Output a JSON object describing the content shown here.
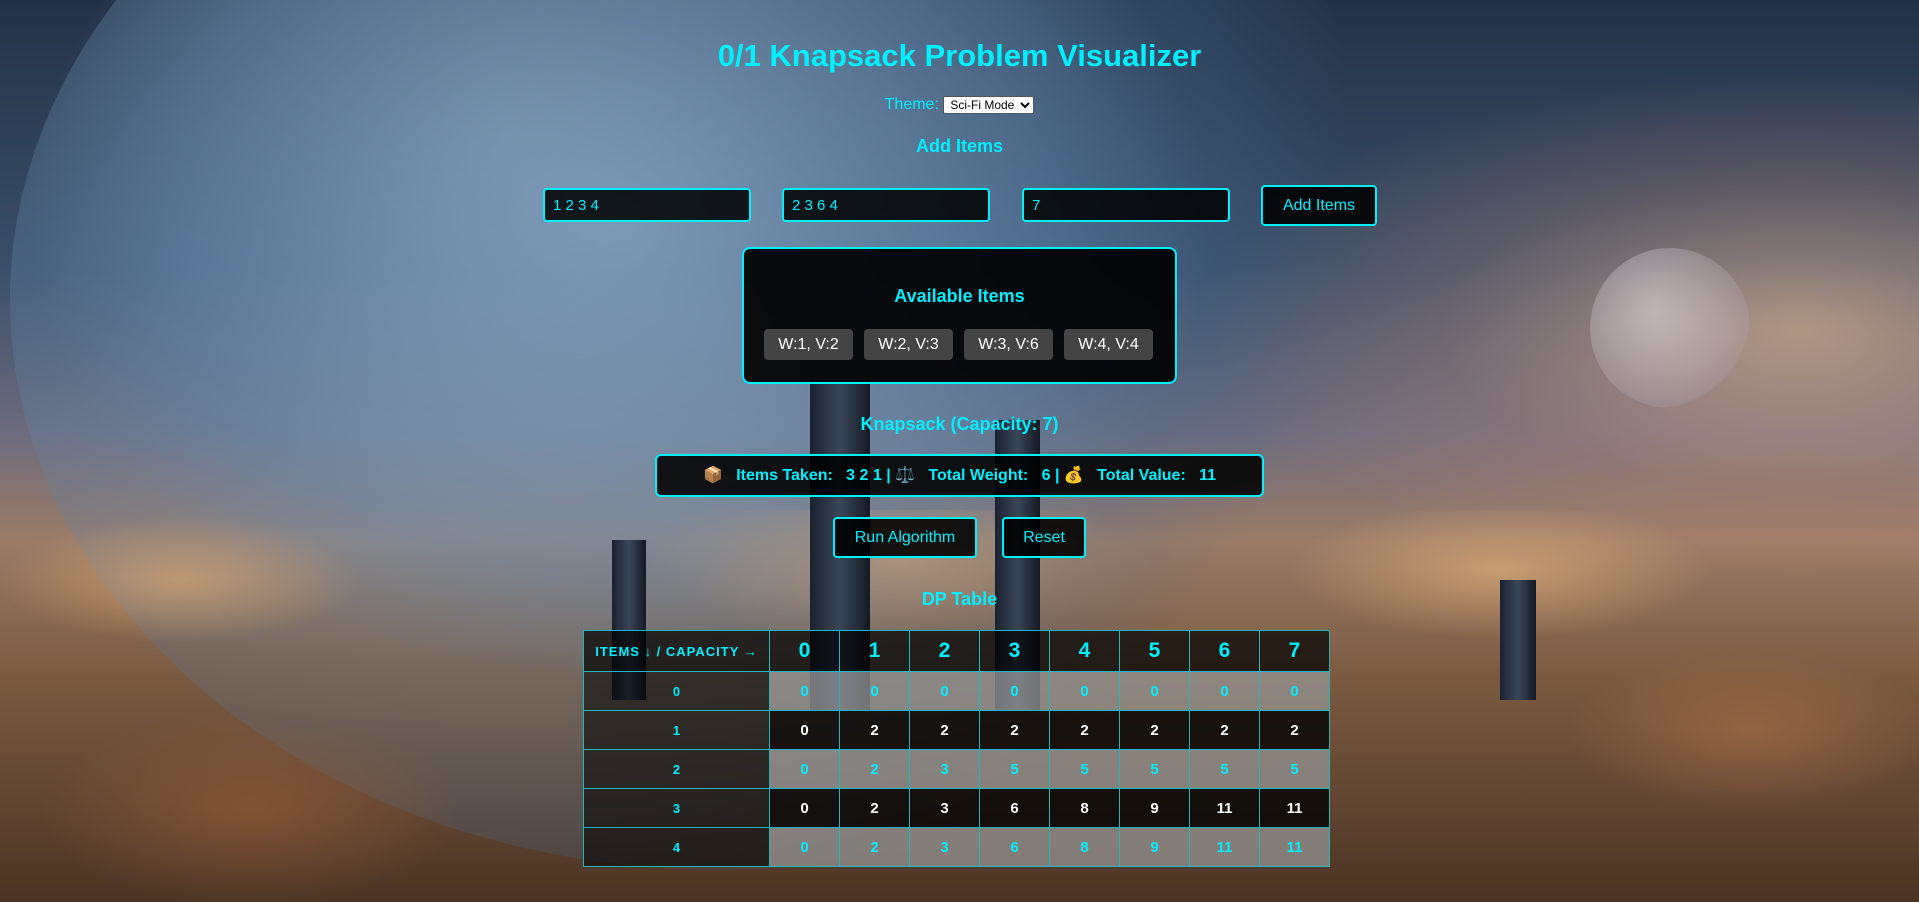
{
  "title": "0/1 Knapsack Problem Visualizer",
  "theme": {
    "label": "Theme:",
    "selected": "Sci-Fi Mode"
  },
  "add_items": {
    "heading": "Add Items",
    "weights_value": "1 2 3 4",
    "values_value": "2 3 6 4",
    "capacity_value": "7",
    "button_label": "Add Items"
  },
  "available_items": {
    "heading": "Available Items",
    "items": [
      "W:1, V:2",
      "W:2, V:3",
      "W:3, V:6",
      "W:4, V:4"
    ]
  },
  "knapsack": {
    "heading": "Knapsack (Capacity: 7)",
    "items_taken_icon": "📦",
    "items_taken_label": "Items Taken:",
    "items_taken_value": "3 2 1",
    "weight_icon": "⚖️",
    "weight_label": "Total Weight:",
    "weight_value": "6",
    "value_icon": "💰",
    "value_label": "Total Value:",
    "value_value": "11",
    "separator": "|"
  },
  "controls": {
    "run_label": "Run Algorithm",
    "reset_label": "Reset"
  },
  "dp_table": {
    "heading": "DP Table",
    "corner_label": "ITEMS ↓ / CAPACITY →",
    "capacities": [
      "0",
      "1",
      "2",
      "3",
      "4",
      "5",
      "6",
      "7"
    ],
    "rows": [
      {
        "item": "0",
        "cells": [
          "0",
          "0",
          "0",
          "0",
          "0",
          "0",
          "0",
          "0"
        ]
      },
      {
        "item": "1",
        "cells": [
          "0",
          "2",
          "2",
          "2",
          "2",
          "2",
          "2",
          "2"
        ]
      },
      {
        "item": "2",
        "cells": [
          "0",
          "2",
          "3",
          "5",
          "5",
          "5",
          "5",
          "5"
        ]
      },
      {
        "item": "3",
        "cells": [
          "0",
          "2",
          "3",
          "6",
          "8",
          "9",
          "11",
          "11"
        ]
      },
      {
        "item": "4",
        "cells": [
          "0",
          "2",
          "3",
          "6",
          "8",
          "9",
          "11",
          "11"
        ]
      }
    ]
  },
  "colors": {
    "accent": "#00f0ff",
    "panel": "#000000",
    "chip": "#444444"
  }
}
